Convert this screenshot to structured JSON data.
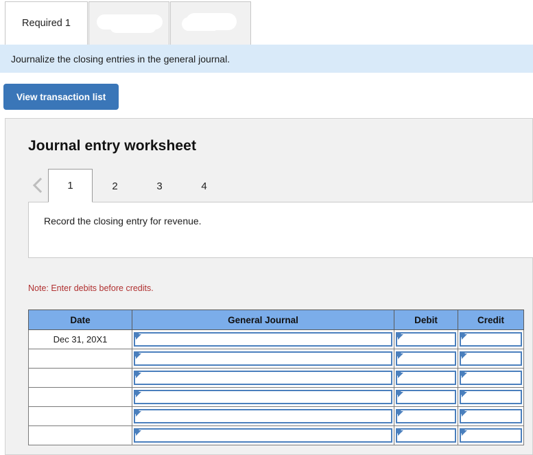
{
  "requirement_tabs": [
    {
      "label": "Required 1",
      "active": true,
      "redacted": false
    },
    {
      "label": "",
      "active": false,
      "redacted": true
    },
    {
      "label": "",
      "active": false,
      "redacted": true
    }
  ],
  "banner": {
    "text": "Journalize the closing entries in the general journal."
  },
  "toolbar": {
    "view_transaction_list_label": "View transaction list"
  },
  "worksheet": {
    "title": "Journal entry worksheet",
    "prev_icon": "chevron-left-icon",
    "page_tabs": [
      {
        "label": "1",
        "active": true
      },
      {
        "label": "2",
        "active": false
      },
      {
        "label": "3",
        "active": false
      },
      {
        "label": "4",
        "active": false
      }
    ],
    "instruction": "Record the closing entry for revenue.",
    "note": "Note: Enter debits before credits."
  },
  "journal": {
    "columns": [
      "Date",
      "General Journal",
      "Debit",
      "Credit"
    ],
    "rows": [
      {
        "date": "Dec 31, 20X1",
        "general_journal": "",
        "debit": "",
        "credit": ""
      },
      {
        "date": "",
        "general_journal": "",
        "debit": "",
        "credit": ""
      },
      {
        "date": "",
        "general_journal": "",
        "debit": "",
        "credit": ""
      },
      {
        "date": "",
        "general_journal": "",
        "debit": "",
        "credit": ""
      },
      {
        "date": "",
        "general_journal": "",
        "debit": "",
        "credit": ""
      },
      {
        "date": "",
        "general_journal": "",
        "debit": "",
        "credit": ""
      }
    ]
  },
  "colors": {
    "banner_bg": "#d9eaf9",
    "button_bg": "#3a76b8",
    "table_header_bg": "#7badea",
    "field_border": "#4a7fbd",
    "note_text": "#b03030",
    "panel_bg": "#f1f1f1"
  }
}
